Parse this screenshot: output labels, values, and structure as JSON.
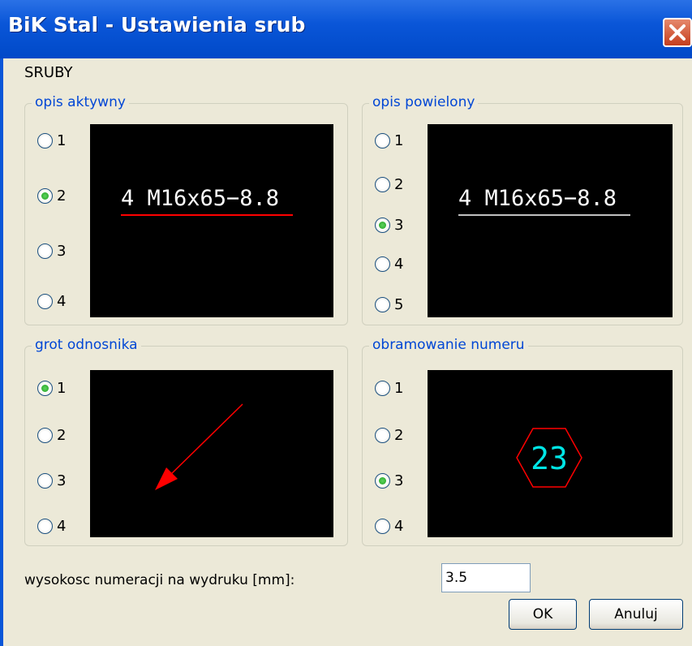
{
  "window": {
    "title": "BiK Stal - Ustawienia srub",
    "close_icon": "close-icon"
  },
  "section_title": "SRUBY",
  "groups": {
    "opis_aktywny": {
      "legend": "opis aktywny",
      "options": [
        "1",
        "2",
        "3",
        "4"
      ],
      "selected": "2",
      "preview_text": "4 M16x65−8.8",
      "underline_color": "#ff0000",
      "text_color": "#ffffff"
    },
    "opis_powielony": {
      "legend": "opis powielony",
      "options": [
        "1",
        "2",
        "3",
        "4",
        "5"
      ],
      "selected": "3",
      "preview_text": "4 M16x65−8.8",
      "underline_color": "#ffffff",
      "text_color": "#ffffff"
    },
    "grot_odnosnika": {
      "legend": "grot odnosnika",
      "options": [
        "1",
        "2",
        "3",
        "4"
      ],
      "selected": "1",
      "preview_icon": "arrow-icon",
      "arrow_color": "#ff0000"
    },
    "obramowanie_numeru": {
      "legend": "obramowanie numeru",
      "options": [
        "1",
        "2",
        "3",
        "4"
      ],
      "selected": "3",
      "preview_number": "23",
      "frame_color": "#ff0000",
      "number_color": "#00e5e5"
    }
  },
  "height_field": {
    "label": "wysokosc numeracji na wydruku [mm]:",
    "value": "3.5"
  },
  "buttons": {
    "ok": "OK",
    "cancel": "Anuluj"
  }
}
